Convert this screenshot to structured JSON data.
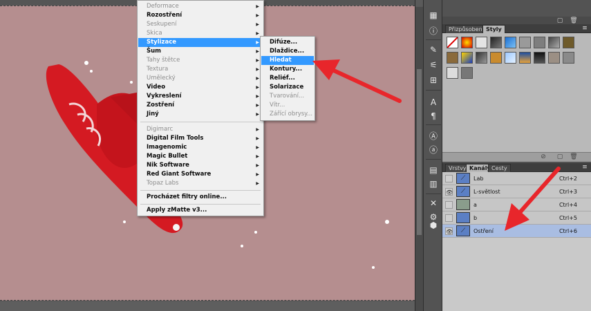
{
  "filter_menu": {
    "items": [
      {
        "label": "Deformace",
        "enabled": false,
        "submenu": true
      },
      {
        "label": "Rozostření",
        "enabled": true,
        "submenu": true
      },
      {
        "label": "Seskupení",
        "enabled": false,
        "submenu": true
      },
      {
        "label": "Skica",
        "enabled": false,
        "submenu": true
      },
      {
        "label": "Stylizace",
        "enabled": true,
        "submenu": true,
        "highlighted": true
      },
      {
        "label": "Šum",
        "enabled": true,
        "submenu": true
      },
      {
        "label": "Tahy štětce",
        "enabled": false,
        "submenu": true
      },
      {
        "label": "Textura",
        "enabled": false,
        "submenu": true
      },
      {
        "label": "Umělecký",
        "enabled": false,
        "submenu": true
      },
      {
        "label": "Video",
        "enabled": true,
        "submenu": true
      },
      {
        "label": "Vykreslení",
        "enabled": true,
        "submenu": true
      },
      {
        "label": "Zostření",
        "enabled": true,
        "submenu": true
      },
      {
        "label": "Jiný",
        "enabled": true,
        "submenu": true
      },
      {
        "label": "Digimarc",
        "enabled": false,
        "submenu": true
      },
      {
        "label": "Digital Film Tools",
        "enabled": true,
        "submenu": true
      },
      {
        "label": "Imagenomic",
        "enabled": true,
        "submenu": true
      },
      {
        "label": "Magic Bullet",
        "enabled": true,
        "submenu": true
      },
      {
        "label": "Nik Software",
        "enabled": true,
        "submenu": true
      },
      {
        "label": "Red Giant Software",
        "enabled": true,
        "submenu": true
      },
      {
        "label": "Topaz Labs",
        "enabled": false,
        "submenu": true
      },
      {
        "label": "Procházet filtry online...",
        "enabled": true,
        "submenu": false
      },
      {
        "label": "Apply zMatte v3...",
        "enabled": true,
        "submenu": false
      }
    ]
  },
  "stylize_submenu": {
    "items": [
      {
        "label": "Difúze...",
        "enabled": true
      },
      {
        "label": "Dlaždice...",
        "enabled": true
      },
      {
        "label": "Hledat obrysy",
        "enabled": true,
        "highlighted": true
      },
      {
        "label": "Kontury...",
        "enabled": true
      },
      {
        "label": "Reliéf...",
        "enabled": true
      },
      {
        "label": "Solarizace",
        "enabled": true
      },
      {
        "label": "Tvarování...",
        "enabled": false
      },
      {
        "label": "Vítr...",
        "enabled": false
      },
      {
        "label": "Zářící obrysy...",
        "enabled": false
      }
    ]
  },
  "styles_panel": {
    "tabs": [
      "Přizpůsobení",
      "Styly"
    ],
    "active_tab": "Styly"
  },
  "channels_panel": {
    "tabs": [
      "Vrstvy",
      "Kanály",
      "Cesty"
    ],
    "active_tab": "Kanály",
    "rows": [
      {
        "name": "Lab",
        "shortcut": "Ctrl+2",
        "visible": false,
        "thumb": "#5b7fc4"
      },
      {
        "name": "L-světlost",
        "shortcut": "Ctrl+3",
        "visible": true,
        "thumb": "#5b7fc4"
      },
      {
        "name": "a",
        "shortcut": "Ctrl+4",
        "visible": false,
        "thumb": "#8a9d8c"
      },
      {
        "name": "b",
        "shortcut": "Ctrl+5",
        "visible": false,
        "thumb": "#5b7fc4"
      },
      {
        "name": "Ostření",
        "shortcut": "Ctrl+6",
        "visible": true,
        "thumb": "#5b7fc4",
        "selected": true
      }
    ]
  },
  "colors": {
    "canvas": "#b58e8f",
    "snowboard": "#d41a22",
    "highlight": "#3399ff",
    "annotation_arrow": "#e8262b"
  }
}
